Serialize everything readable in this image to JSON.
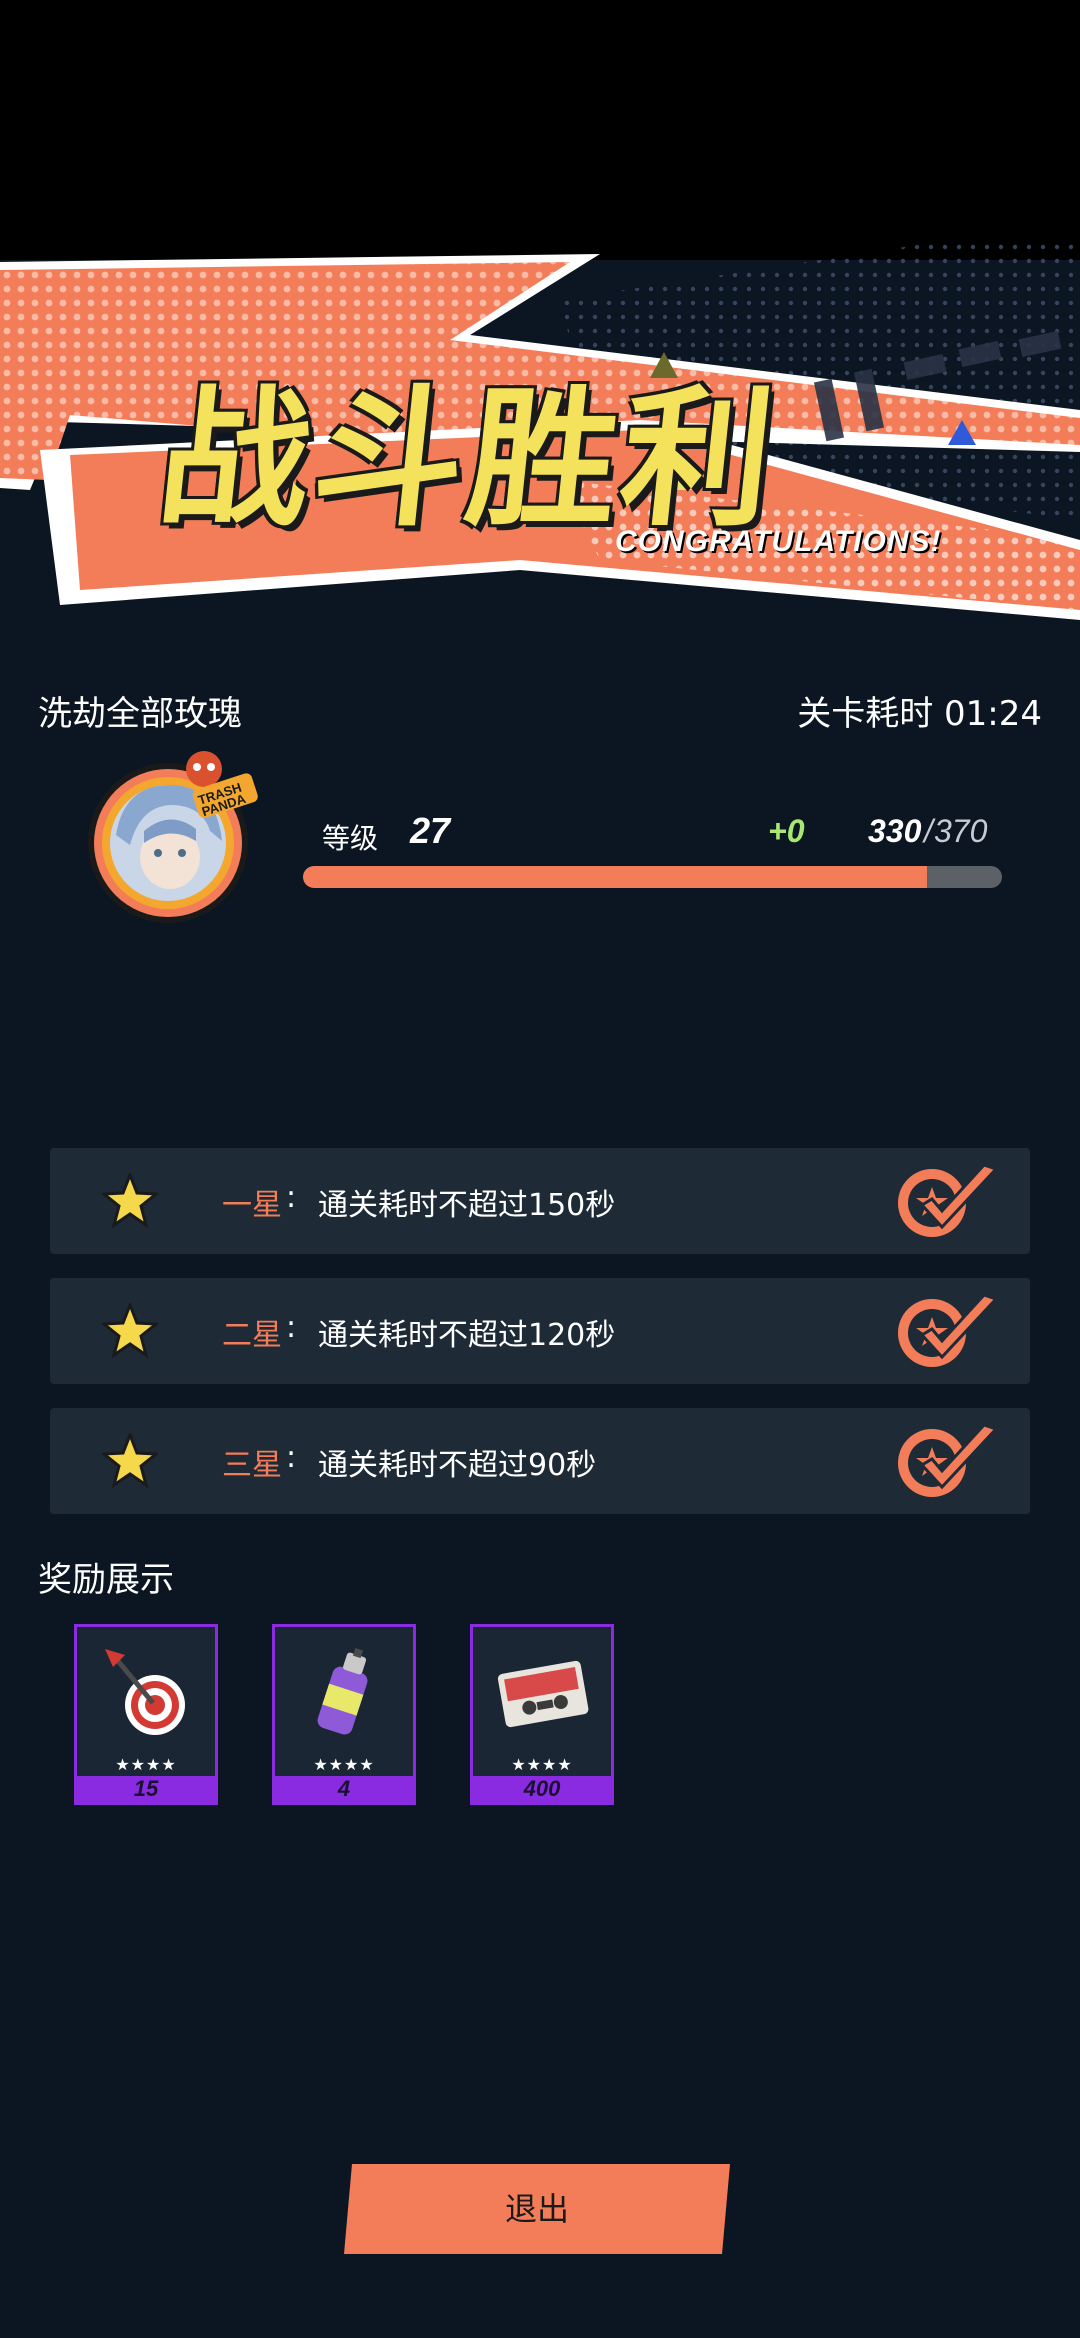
{
  "banner": {
    "title": "战斗胜利",
    "subtitle": "CONGRATULATIONS!"
  },
  "stage": {
    "name": "洗劫全部玫瑰",
    "time_label": "关卡耗时 01:24"
  },
  "player": {
    "avatar_badge": "TRASH PANDA",
    "level_label": "等级",
    "level": "27",
    "exp_gain": "+0",
    "exp_current": "330",
    "exp_separator": "/",
    "exp_max": "370",
    "exp_fraction": 0.892
  },
  "objectives": [
    {
      "label": "一星",
      "colon": ":",
      "text": "通关耗时不超过150秒",
      "completed": true
    },
    {
      "label": "二星",
      "colon": ":",
      "text": "通关耗时不超过120秒",
      "completed": true
    },
    {
      "label": "三星",
      "colon": ":",
      "text": "通关耗时不超过90秒",
      "completed": true
    }
  ],
  "rewards": {
    "title": "奖励展示",
    "items": [
      {
        "icon": "dart-target-icon",
        "stars": "★★★★",
        "qty": "15"
      },
      {
        "icon": "spray-can-icon",
        "stars": "★★★★",
        "qty": "4"
      },
      {
        "icon": "cassette-tape-icon",
        "stars": "★★★★",
        "qty": "400"
      }
    ]
  },
  "exit_button": {
    "label": "退出"
  },
  "colors": {
    "accent": "#f47d59",
    "title_yellow": "#f5e25c",
    "exp_gain_green": "#a8e870",
    "reward_frame": "#8a2be2",
    "background": "#0b1622",
    "panel": "#1e2a36"
  }
}
